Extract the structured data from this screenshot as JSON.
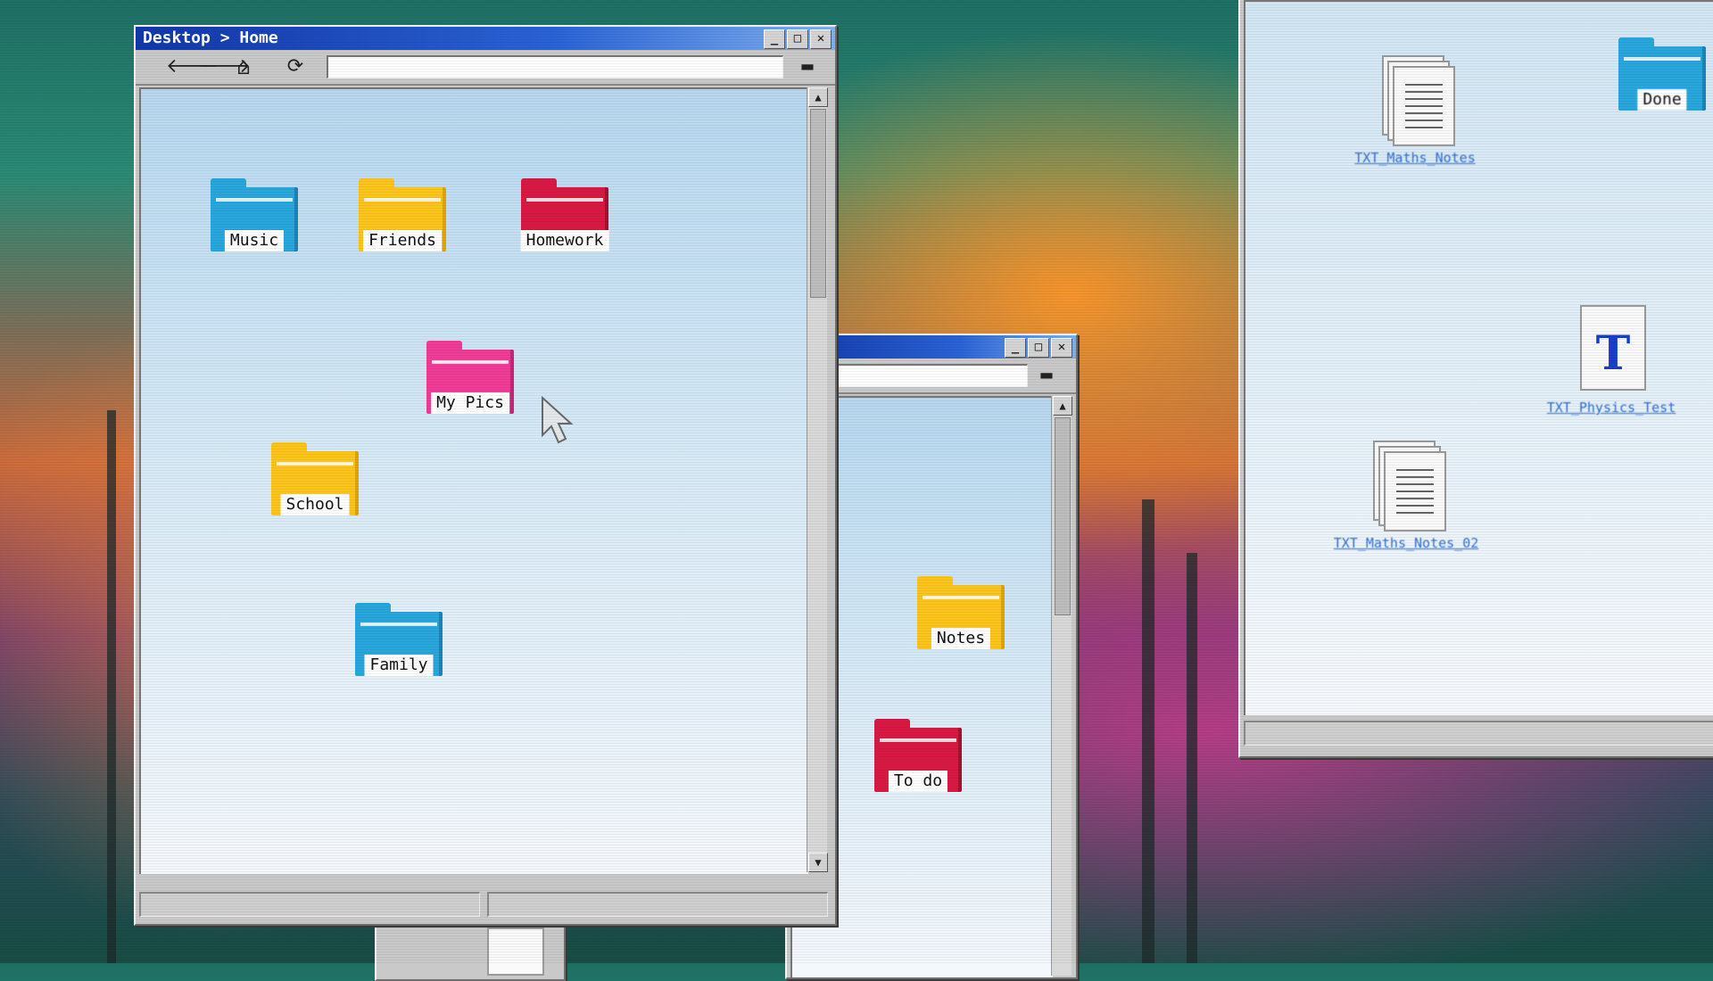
{
  "main_window": {
    "title": "Desktop > Home",
    "address": "",
    "buttons": {
      "minimize": "_",
      "maximize": "□",
      "close": "✕"
    },
    "toolbar": {
      "back": "🡐",
      "forward": "🡒",
      "home": "⌂",
      "refresh": "⟳",
      "open_folder": "▬"
    },
    "folders": [
      {
        "label": "Music",
        "color": "blue"
      },
      {
        "label": "Friends",
        "color": "yellow"
      },
      {
        "label": "Homework",
        "color": "red"
      },
      {
        "label": "My Pics",
        "color": "pink"
      },
      {
        "label": "School",
        "color": "yellow"
      },
      {
        "label": "Family",
        "color": "blue"
      }
    ]
  },
  "middle_window": {
    "buttons": {
      "minimize": "_",
      "maximize": "□",
      "close": "✕"
    },
    "address": "",
    "folders": [
      {
        "label": "Notes",
        "color": "yellow"
      },
      {
        "label": "To do",
        "color": "red"
      }
    ]
  },
  "right_window": {
    "files": [
      {
        "label": "TXT_Maths_Notes",
        "icon": "document-stack-icon"
      },
      {
        "label": "Done",
        "icon": "folder-icon"
      },
      {
        "label": "TXT_Physics_Test",
        "icon": "text-document-icon",
        "letter": "T"
      },
      {
        "label": "TXT_Maths_Notes_02",
        "icon": "document-stack-icon"
      }
    ]
  },
  "colors": {
    "title_bar": "#1237a8",
    "folder_blue": "#29a6dc",
    "folder_yellow": "#fcc51c",
    "folder_red": "#d81943",
    "folder_pink": "#f03c97"
  }
}
